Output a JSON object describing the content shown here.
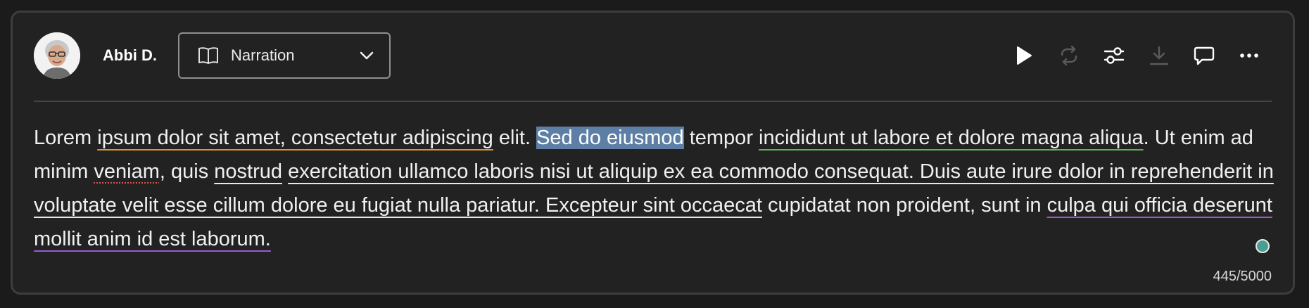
{
  "user": {
    "name": "Abbi D."
  },
  "mode": {
    "label": "Narration"
  },
  "toolbar": {
    "icons": [
      "play-icon",
      "regenerate-icon",
      "settings-sliders-icon",
      "download-icon",
      "comment-icon",
      "more-options-icon"
    ]
  },
  "text": {
    "segments": [
      "Lorem ",
      "ipsum dolor sit amet, consectetur adipiscing",
      " elit. ",
      "Sed do eiusmod",
      " tempor ",
      "incididunt ut labore et dolore magna aliqua",
      ". Ut enim ad minim ",
      "veniam",
      ", quis ",
      "nostrud",
      " ",
      "exercitation ullamco laboris nisi ut aliquip ex ea commodo consequat. Duis aute irure dolor in reprehenderit in voluptate velit esse cillum dolore eu fugiat nulla pariatur. Excepteur sint occaecat",
      " cupidatat non proident, sunt in ",
      "culpa qui officia deserunt mollit anim id est laborum."
    ]
  },
  "char_count": "445/5000",
  "colors": {
    "background": "#222222",
    "selection": "#5d7fa6",
    "status_dot": "#46a091",
    "underline_orange": "#e0982e",
    "underline_green": "#5cb85c",
    "underline_purple": "#9b59d6",
    "spellcheck": "#d9534f"
  }
}
